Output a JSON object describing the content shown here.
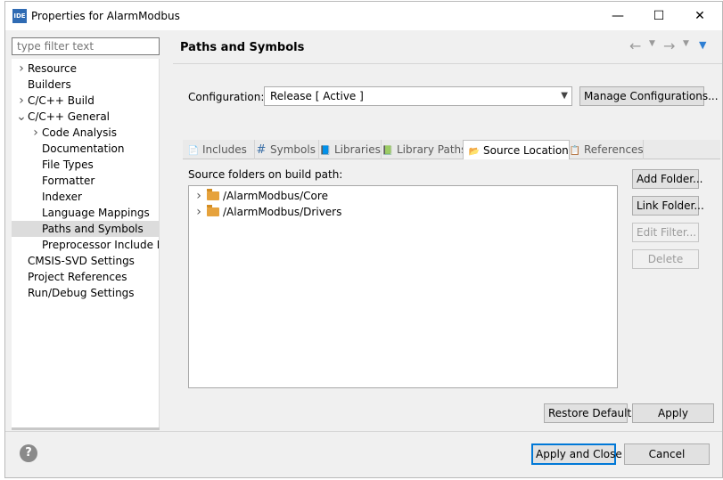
{
  "window": {
    "title": "Properties for AlarmModbus",
    "icon_text": "IDE",
    "minimize": "—",
    "maximize": "☐",
    "close": "✕"
  },
  "filter": {
    "placeholder": "type filter text"
  },
  "tree": [
    {
      "label": "Resource",
      "twisty": ">",
      "indent": 0
    },
    {
      "label": "Builders",
      "twisty": "",
      "indent": 0
    },
    {
      "label": "C/C++ Build",
      "twisty": ">",
      "indent": 0
    },
    {
      "label": "C/C++ General",
      "twisty": "v",
      "indent": 0
    },
    {
      "label": "Code Analysis",
      "twisty": ">",
      "indent": 1
    },
    {
      "label": "Documentation",
      "twisty": "",
      "indent": 1
    },
    {
      "label": "File Types",
      "twisty": "",
      "indent": 1
    },
    {
      "label": "Formatter",
      "twisty": "",
      "indent": 1
    },
    {
      "label": "Indexer",
      "twisty": "",
      "indent": 1
    },
    {
      "label": "Language Mappings",
      "twisty": "",
      "indent": 1
    },
    {
      "label": "Paths and Symbols",
      "twisty": "",
      "indent": 1,
      "selected": true
    },
    {
      "label": "Preprocessor Include Pat",
      "twisty": "",
      "indent": 1
    },
    {
      "label": "CMSIS-SVD Settings",
      "twisty": "",
      "indent": 0
    },
    {
      "label": "Project References",
      "twisty": "",
      "indent": 0
    },
    {
      "label": "Run/Debug Settings",
      "twisty": "",
      "indent": 0
    }
  ],
  "page": {
    "title": "Paths and Symbols"
  },
  "configuration": {
    "label": "Configuration:",
    "value": "Release  [ Active ]",
    "manage_label": "Manage Configurations..."
  },
  "tabs": [
    {
      "label": "Includes",
      "icon": "include-icon"
    },
    {
      "label": "Symbols",
      "icon": "hash-icon"
    },
    {
      "label": "Libraries",
      "icon": "library-icon"
    },
    {
      "label": "Library Paths",
      "icon": "library-path-icon"
    },
    {
      "label": "Source Location",
      "icon": "folder-open-icon",
      "active": true
    },
    {
      "label": "References",
      "icon": "reference-icon"
    }
  ],
  "source": {
    "label": "Source folders on build path:",
    "folders": [
      "/AlarmModbus/Core",
      "/AlarmModbus/Drivers"
    ],
    "buttons": {
      "add": "Add Folder...",
      "link": "Link Folder...",
      "edit": "Edit Filter...",
      "delete": "Delete"
    }
  },
  "footer": {
    "restore": "Restore Defaults",
    "apply": "Apply",
    "apply_close": "Apply and Close",
    "cancel": "Cancel",
    "help": "?"
  }
}
